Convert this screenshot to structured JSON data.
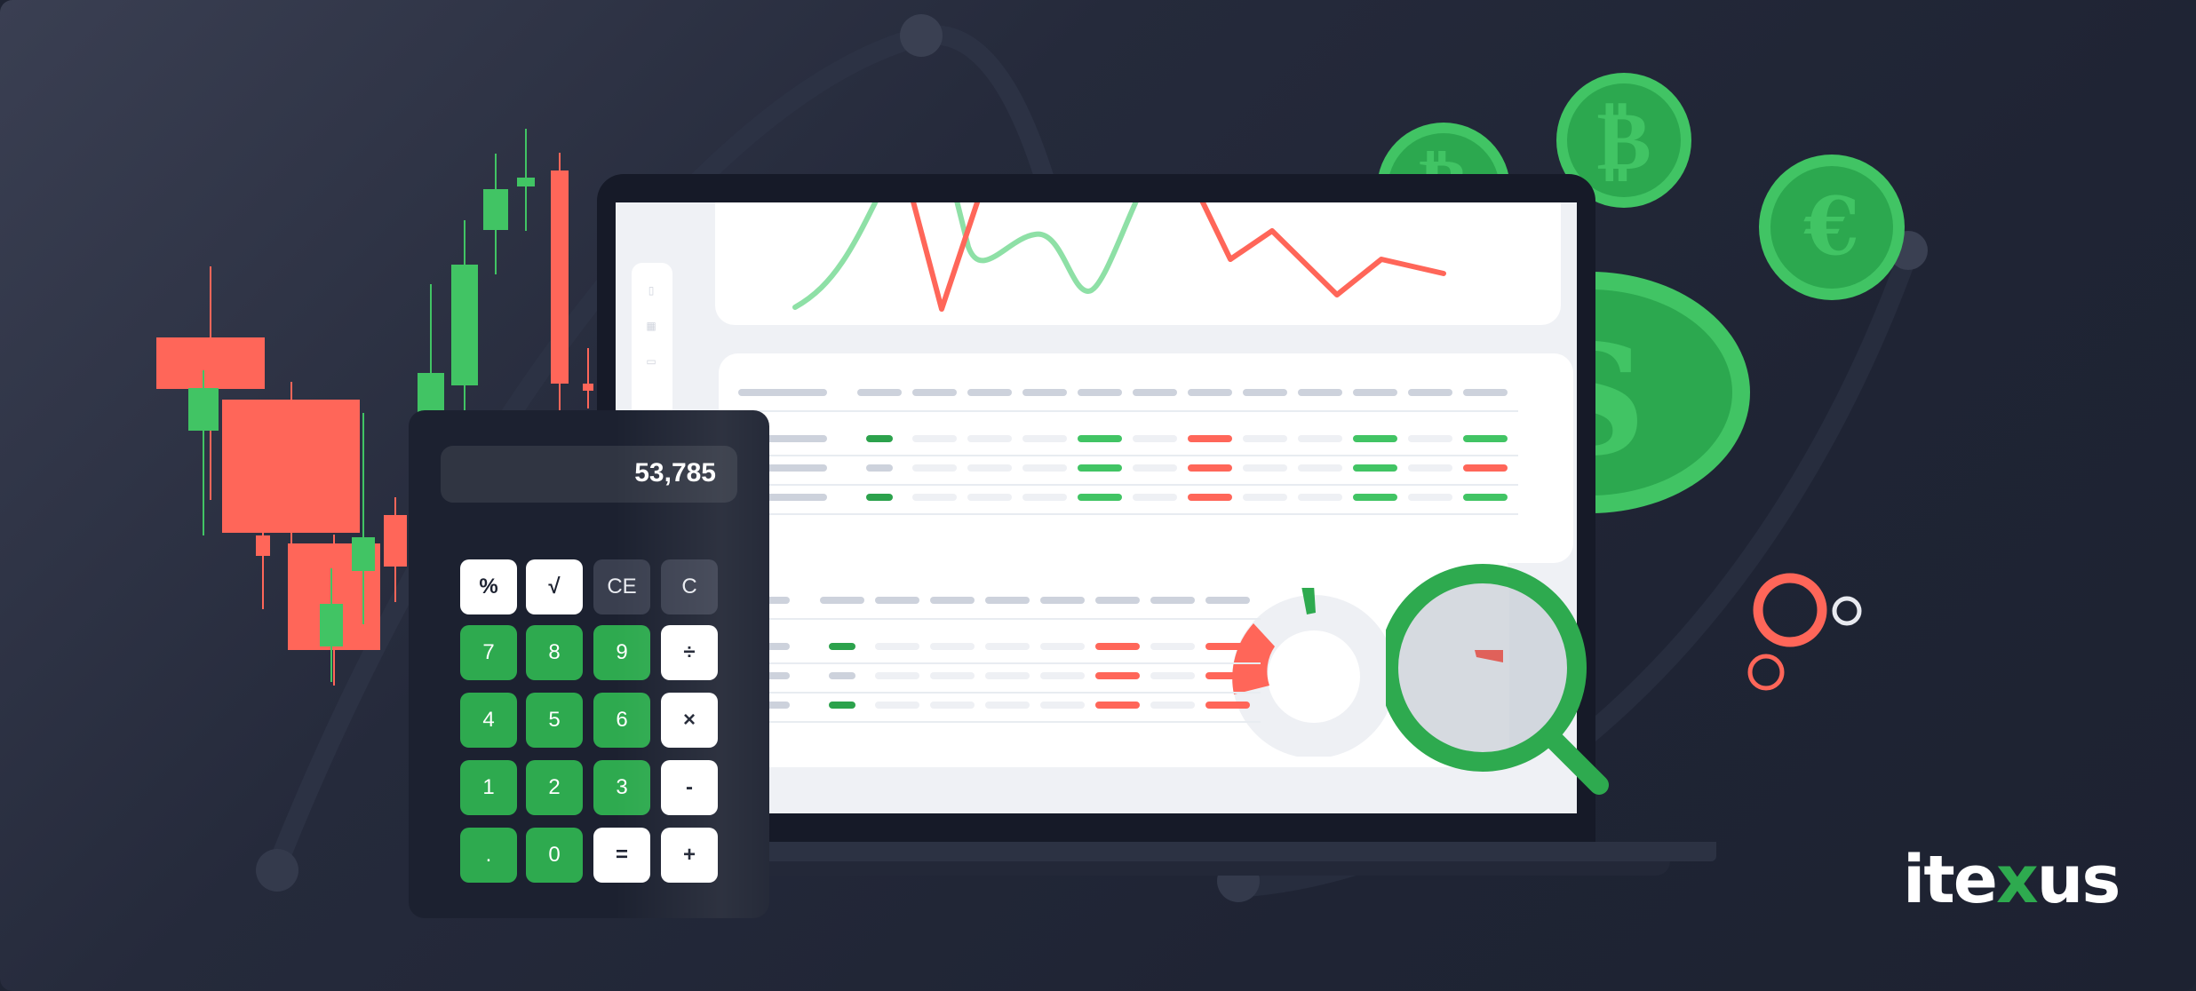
{
  "calculator": {
    "display_value": "53,785",
    "keys": [
      {
        "label": "%",
        "style": "white"
      },
      {
        "label": "√",
        "style": "white"
      },
      {
        "label": "CE",
        "style": "dark"
      },
      {
        "label": "C",
        "style": "dark"
      },
      {
        "label": "7",
        "style": "green"
      },
      {
        "label": "8",
        "style": "green"
      },
      {
        "label": "9",
        "style": "green"
      },
      {
        "label": "÷",
        "style": "white"
      },
      {
        "label": "4",
        "style": "green"
      },
      {
        "label": "5",
        "style": "green"
      },
      {
        "label": "6",
        "style": "green"
      },
      {
        "label": "×",
        "style": "white"
      },
      {
        "label": "1",
        "style": "green"
      },
      {
        "label": "2",
        "style": "green"
      },
      {
        "label": "3",
        "style": "green"
      },
      {
        "label": "-",
        "style": "white"
      },
      {
        "label": ".",
        "style": "green"
      },
      {
        "label": "0",
        "style": "green"
      },
      {
        "label": "=",
        "style": "white"
      },
      {
        "label": "+",
        "style": "white"
      }
    ]
  },
  "coins": [
    {
      "symbol": "₿",
      "name": "bitcoin"
    },
    {
      "symbol": "₿",
      "name": "bitcoin"
    },
    {
      "symbol": "€",
      "name": "euro"
    },
    {
      "symbol": "$",
      "name": "dollar"
    }
  ],
  "dashboard": {
    "sidebar_icons": [
      "clipboard-icon",
      "grid-icon",
      "document-icon",
      "chart-icon"
    ],
    "table1_rows": [
      [
        "dg",
        "gr",
        "rd",
        "gr",
        "gr"
      ],
      [
        "g",
        "gr",
        "rd",
        "gr",
        "rd"
      ],
      [
        "dg",
        "gr",
        "rd",
        "gr",
        "gr"
      ]
    ],
    "table2_rows": [
      [
        "dg",
        "rd",
        "rd"
      ],
      [
        "g",
        "rd",
        "rd"
      ],
      [
        "dg",
        "rd",
        "rd"
      ]
    ]
  },
  "brand": {
    "logo_prefix": "ite",
    "logo_accent": "x",
    "logo_suffix": "us",
    "colors": {
      "green": "#2eaa4f",
      "light_green": "#41c464",
      "red": "#ff6659",
      "background": "#1f2434"
    }
  }
}
